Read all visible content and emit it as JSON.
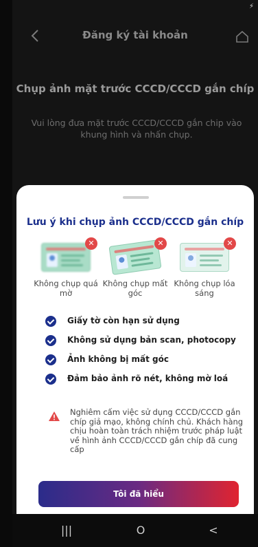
{
  "status_bar": {
    "charging_icon": "bolt-icon"
  },
  "header": {
    "title": "Đăng ký tài khoản",
    "back_icon": "chevron-left-icon",
    "home_icon": "home-icon"
  },
  "background": {
    "title": "Chụp ảnh mặt trước CCCD/CCCD gắn chíp",
    "description": "Vui lòng đưa mặt trước CCCD/CCCD gắn chip vào khung hình và nhấn chụp."
  },
  "sheet": {
    "title": "Lưu ý khi chụp ảnh CCCD/CCCD gắn chíp",
    "examples": [
      {
        "label": "Không chụp quá mờ",
        "icon": "blurry-card-icon"
      },
      {
        "label": "Không chụp mất góc",
        "icon": "cropped-card-icon"
      },
      {
        "label": "Không chụp lóa sáng",
        "icon": "glare-card-icon"
      }
    ],
    "rules": [
      "Giấy tờ còn hạn sử dụng",
      "Không sử dụng bản scan, photocopy",
      "Ảnh không bị mất góc",
      "Đảm bảo ảnh rõ nét, không mờ loá"
    ],
    "warning": "Nghiêm cấm việc sử dụng CCCD/CCCD gắn chíp giả mạo, không chính chủ. Khách hàng chịu hoàn toàn trách nhiệm trước pháp luật về hình ảnh CCCD/CCCD gắn chíp đã cung cấp",
    "confirm_button": "Tôi đã hiểu"
  },
  "nav_bar": {
    "recents_glyph": "|||",
    "home_glyph": "O",
    "back_glyph": "<"
  },
  "colors": {
    "accent": "#1b2f8c",
    "danger": "#e24848",
    "button_gradient_start": "#2b2c8a",
    "button_gradient_end": "#e02430"
  }
}
